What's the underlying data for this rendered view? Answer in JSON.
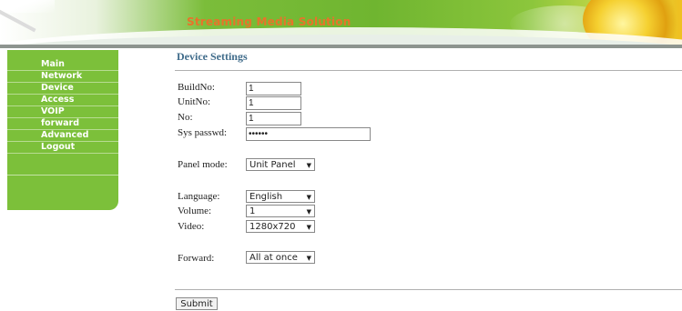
{
  "header": {
    "title": "Streaming Media Solution"
  },
  "sidebar": {
    "items": [
      {
        "label": "Main"
      },
      {
        "label": "Network"
      },
      {
        "label": "Device"
      },
      {
        "label": "Access"
      },
      {
        "label": "VOIP"
      },
      {
        "label": "forward"
      },
      {
        "label": "Advanced"
      },
      {
        "label": "Logout"
      }
    ]
  },
  "main": {
    "title": "Device Settings",
    "fields": {
      "build_no": {
        "label": "BuildNo:",
        "value": "1"
      },
      "unit_no": {
        "label": "UnitNo:",
        "value": "1"
      },
      "no": {
        "label": "No:",
        "value": "1"
      },
      "sys_passwd": {
        "label": "Sys passwd:",
        "value": "••••••"
      },
      "panel_mode": {
        "label": "Panel mode:",
        "value": "Unit Panel"
      },
      "language": {
        "label": "Language:",
        "value": "English"
      },
      "volume": {
        "label": "Volume:",
        "value": "1"
      },
      "video": {
        "label": "Video:",
        "value": "1280x720"
      },
      "forward": {
        "label": "Forward:",
        "value": "All at once"
      }
    },
    "submit_label": "Submit"
  },
  "colors": {
    "sidebar_green": "#7cc03a",
    "title_orange": "#e8732a",
    "heading_blue": "#3f6b8a"
  },
  "icons": {
    "dropdown": "triangle-down-icon"
  }
}
